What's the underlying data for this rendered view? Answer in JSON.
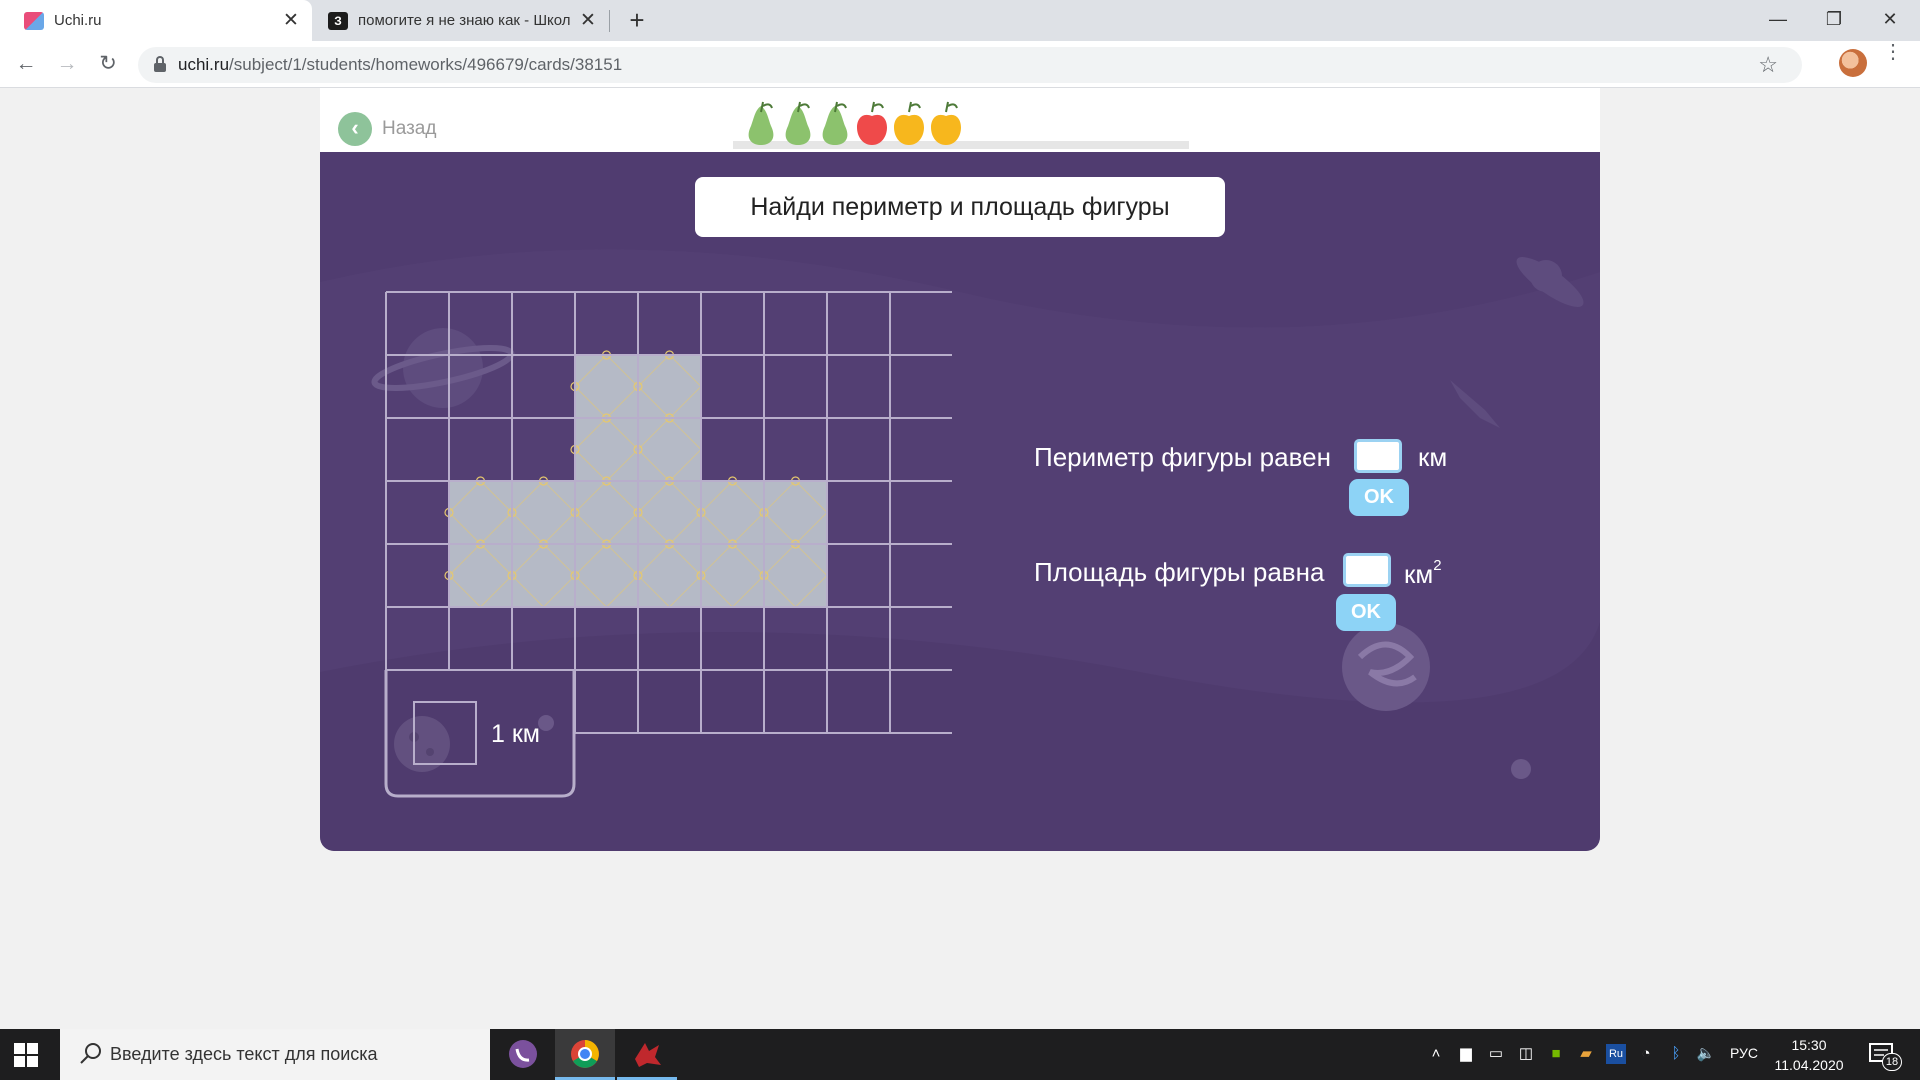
{
  "browser": {
    "tabs": [
      {
        "title": "Uchi.ru",
        "active": true
      },
      {
        "title": "помогите я не знаю как - Школ",
        "favicon_text": "З",
        "active": false
      }
    ],
    "address": {
      "domain": "uchi.ru",
      "path": "/subject/1/students/homeworks/496679/cards/38151"
    }
  },
  "header": {
    "back_label": "Назад",
    "progress_fruits": [
      "pear",
      "pear",
      "pear",
      "apple",
      "lemon",
      "lemon"
    ],
    "fruit_colors": {
      "pear": "#8cc26d",
      "apple": "#ef4a4a",
      "lemon": "#f7b71d"
    }
  },
  "task": {
    "title": "Найди периметр и площадь фигуры",
    "scale_label": "1 км",
    "perimeter": {
      "label": "Периметр фигуры равен",
      "unit": "км",
      "value": "",
      "button": "OK"
    },
    "area": {
      "label": "Площадь фигуры равна",
      "unit": "км",
      "unit_power": "2",
      "value": "",
      "button": "OK"
    }
  },
  "grid": {
    "columns": 9,
    "rows": 7,
    "filled_cells": [
      [
        1,
        3
      ],
      [
        1,
        4
      ],
      [
        2,
        3
      ],
      [
        2,
        4
      ],
      [
        3,
        1
      ],
      [
        3,
        2
      ],
      [
        3,
        3
      ],
      [
        3,
        4
      ],
      [
        3,
        5
      ],
      [
        3,
        6
      ],
      [
        4,
        1
      ],
      [
        4,
        2
      ],
      [
        4,
        3
      ],
      [
        4,
        4
      ],
      [
        4,
        5
      ],
      [
        4,
        6
      ]
    ],
    "colors": {
      "panel": "#533f73",
      "line": "#b8aecb",
      "fill": "#b5bac6",
      "fill_pattern": "#e6c86e"
    }
  },
  "taskbar": {
    "search_placeholder": "Введите здесь текст для поиска",
    "language": "РУС",
    "time": "15:30",
    "date": "11.04.2020",
    "notification_count": "18"
  }
}
